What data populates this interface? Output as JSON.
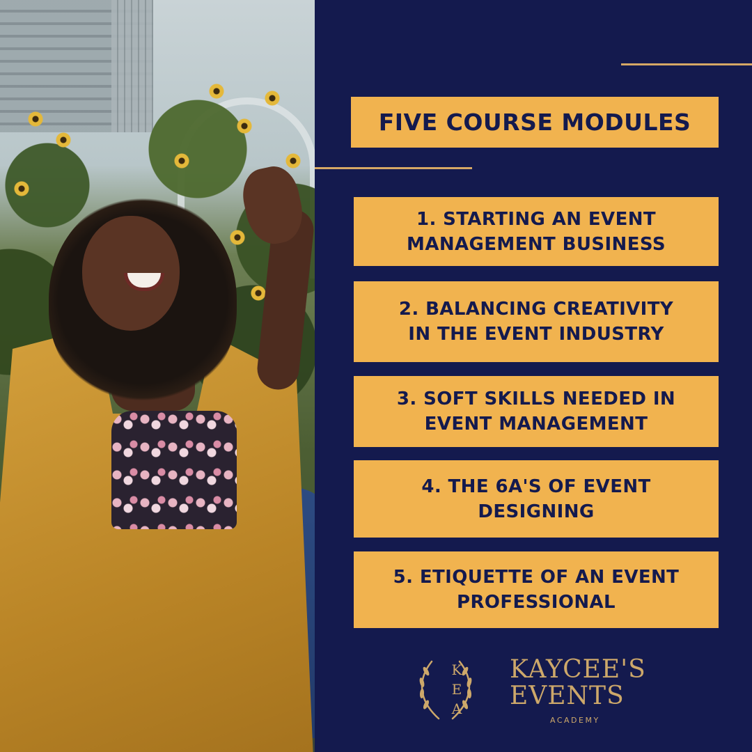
{
  "photo": {
    "alt": "Smiling woman in a mustard cardigan sitting in front of yellow flowers"
  },
  "heading": "FIVE COURSE MODULES",
  "modules": [
    {
      "line1": "1. STARTING AN EVENT",
      "line2": "MANAGEMENT BUSINESS"
    },
    {
      "line1": "2. BALANCING CREATIVITY",
      "line2": "IN THE EVENT INDUSTRY"
    },
    {
      "line1": "3. SOFT SKILLS NEEDED IN",
      "line2": "EVENT MANAGEMENT"
    },
    {
      "line1": "4. THE 6A'S OF EVENT",
      "line2": "DESIGNING"
    },
    {
      "line1": "5. ETIQUETTE OF AN EVENT",
      "line2": "PROFESSIONAL"
    }
  ],
  "logo": {
    "monogram": [
      "K",
      "E",
      "A"
    ],
    "name_line1": "KAYCEE'S",
    "name_line2": "EVENTS",
    "name_line3": "ACADEMY"
  },
  "colors": {
    "navy": "#141a4e",
    "gold_box": "#f1b34f",
    "gold_text": "#cda86a"
  }
}
